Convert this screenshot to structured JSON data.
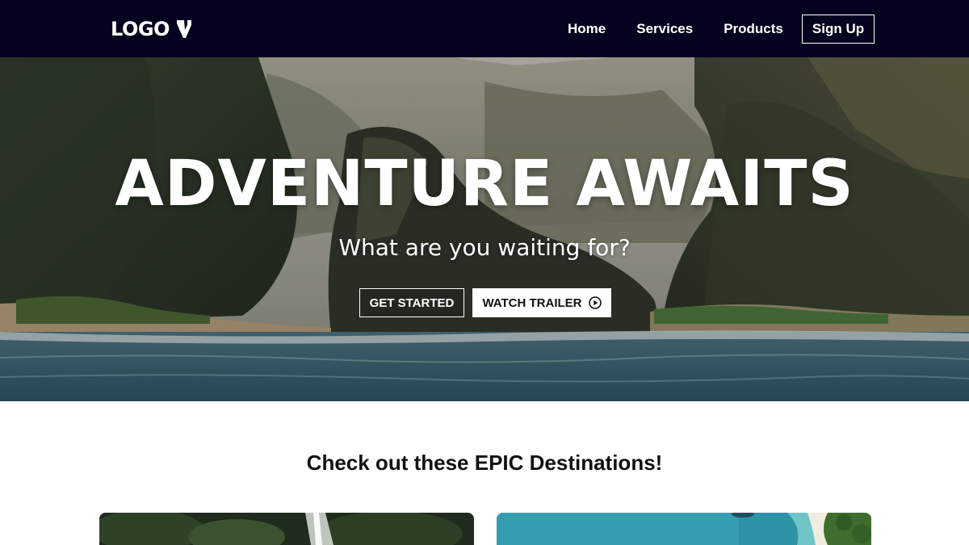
{
  "navbar": {
    "logo_text": "LOGO",
    "links": [
      {
        "label": "Home"
      },
      {
        "label": "Services"
      },
      {
        "label": "Products"
      }
    ],
    "signup_label": "Sign Up"
  },
  "hero": {
    "title": "ADVENTURE AWAITS",
    "subtitle": "What are you waiting for?",
    "primary_button": "GET STARTED",
    "secondary_button": "WATCH TRAILER",
    "secondary_icon": "play-circle-icon"
  },
  "destinations": {
    "heading": "Check out these EPIC Destinations!",
    "cards": [
      {
        "image": "jungle-waterfall-image"
      },
      {
        "image": "tropical-beach-aerial-image"
      }
    ]
  },
  "colors": {
    "navbar_bg": "#03031f",
    "text_light": "#ffffff",
    "text_dark": "#111111"
  }
}
